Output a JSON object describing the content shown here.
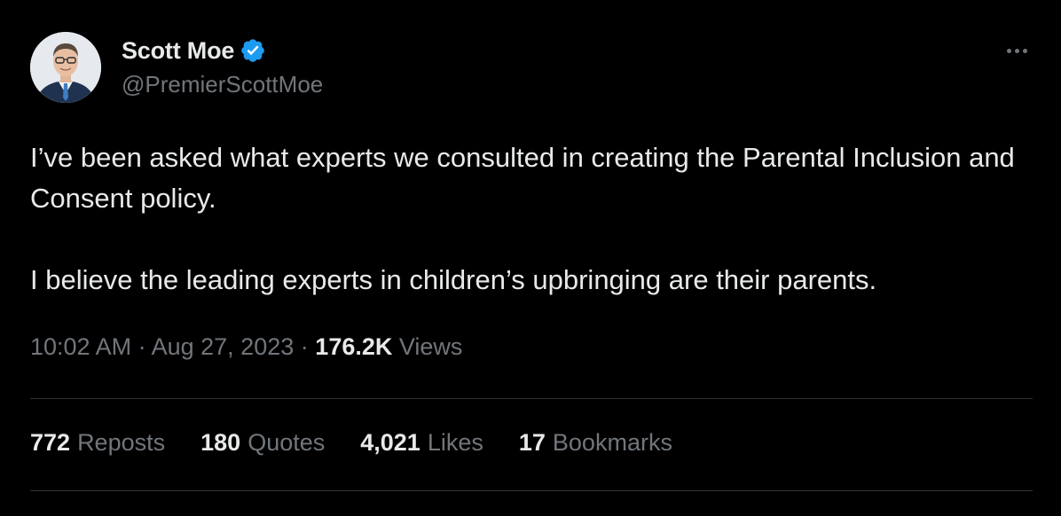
{
  "user": {
    "display_name": "Scott Moe",
    "handle": "@PremierScottMoe",
    "verified_icon": "verified-badge-icon",
    "verified_color": "#1d9bf0"
  },
  "tweet": {
    "paragraphs": [
      "I’ve been asked what experts we consulted in creating the Parental Inclusion and Consent policy.",
      "I believe the leading experts in children’s upbringing are their parents."
    ]
  },
  "meta": {
    "time": "10:02 AM",
    "separator": "·",
    "date": "Aug 27, 2023",
    "views_count": "176.2K",
    "views_label": "Views"
  },
  "stats": {
    "reposts_count": "772",
    "reposts_label": "Reposts",
    "quotes_count": "180",
    "quotes_label": "Quotes",
    "likes_count": "4,021",
    "likes_label": "Likes",
    "bookmarks_count": "17",
    "bookmarks_label": "Bookmarks"
  },
  "colors": {
    "background": "#000000",
    "text_primary": "#e7e9ea",
    "text_secondary": "#71767b",
    "divider": "#2f3336"
  }
}
